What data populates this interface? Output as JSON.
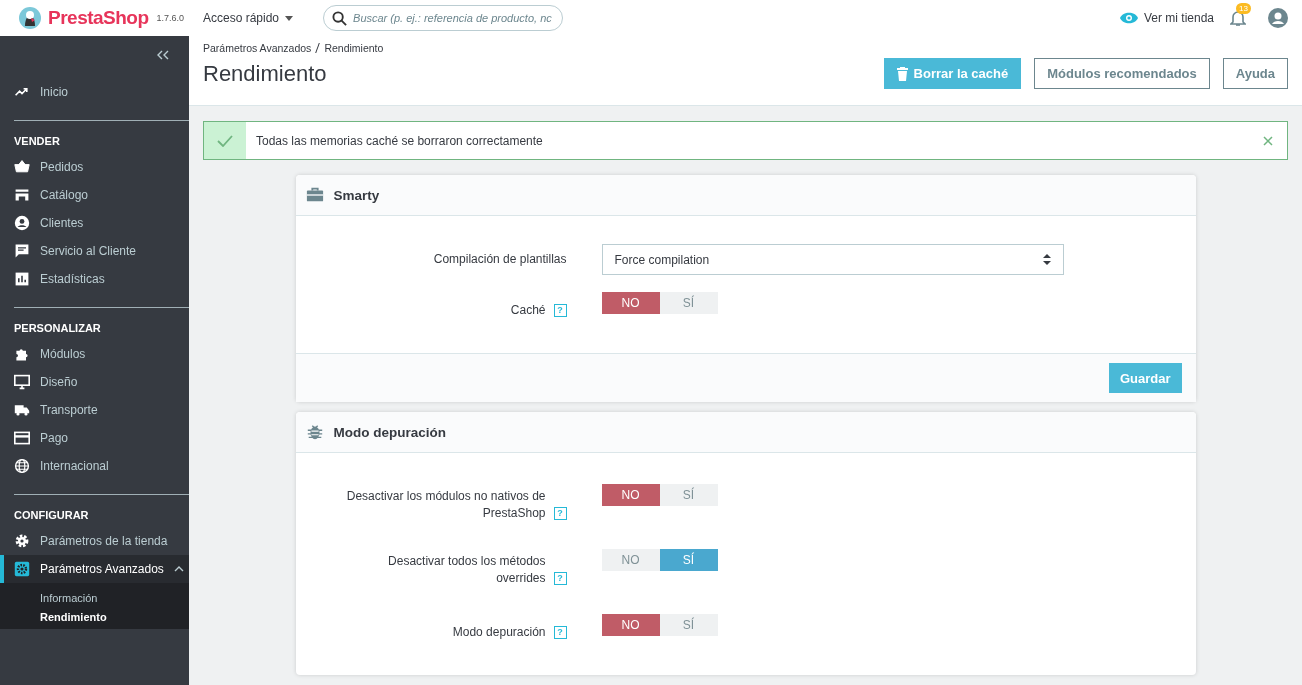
{
  "header": {
    "logo": "PrestaShop",
    "version": "1.7.6.0",
    "quick_access": "Acceso rápido",
    "search": {
      "placeholder": "Buscar (p. ej.: referencia de producto, nc"
    },
    "view_store": "Ver mi tienda",
    "notifications": "13"
  },
  "sidebar": {
    "top": [
      {
        "label": "Inicio"
      }
    ],
    "sections": [
      {
        "title": "VENDER",
        "items": [
          {
            "label": "Pedidos",
            "selected": false
          },
          {
            "label": "Catálogo",
            "selected": false
          },
          {
            "label": "Clientes",
            "selected": false
          },
          {
            "label": "Servicio al Cliente",
            "selected": false
          },
          {
            "label": "Estadísticas",
            "selected": false
          }
        ]
      },
      {
        "title": "PERSONALIZAR",
        "items": [
          {
            "label": "Módulos",
            "selected": false
          },
          {
            "label": "Diseño",
            "selected": false
          },
          {
            "label": "Transporte",
            "selected": false
          },
          {
            "label": "Pago",
            "selected": false
          },
          {
            "label": "Internacional",
            "selected": false
          }
        ]
      },
      {
        "title": "CONFIGURAR",
        "items": [
          {
            "label": "Parámetros de la tienda",
            "selected": false
          },
          {
            "label": "Parámetros Avanzados",
            "selected": true,
            "expanded": true,
            "children": [
              {
                "label": "Información",
                "selected": false
              },
              {
                "label": "Rendimiento",
                "selected": true
              }
            ]
          }
        ]
      }
    ]
  },
  "breadcrumb": [
    "Parámetros Avanzados",
    "Rendimiento"
  ],
  "page_title": "Rendimiento",
  "toolbar": [
    {
      "label": "Borrar la caché",
      "kind": "primary"
    },
    {
      "label": "Módulos recomendados",
      "kind": "outline"
    },
    {
      "label": "Ayuda",
      "kind": "outline"
    }
  ],
  "alert": {
    "message": "Todas las memorias caché se borraron correctamente"
  },
  "panels": [
    {
      "title": "Smarty",
      "fields": [
        {
          "kind": "select",
          "label": "Compilación de plantillas",
          "value": "Force compilation"
        },
        {
          "kind": "toggle",
          "label": "Caché",
          "help": "?",
          "options": [
            {
              "label": "NO",
              "kind": "off",
              "selected": true
            },
            {
              "label": "SÍ",
              "kind": "on",
              "selected": false
            }
          ]
        }
      ],
      "save": "Guardar"
    },
    {
      "title": "Modo depuración",
      "fields": [
        {
          "kind": "toggle",
          "label": "Desactivar los módulos no nativos de PrestaShop",
          "help": "?",
          "options": [
            {
              "label": "NO",
              "kind": "off",
              "selected": true
            },
            {
              "label": "SÍ",
              "kind": "on",
              "selected": false
            }
          ]
        },
        {
          "kind": "toggle",
          "label": "Desactivar todos los métodos overrides",
          "help": "?",
          "options": [
            {
              "label": "NO",
              "kind": "off",
              "selected": false
            },
            {
              "label": "SÍ",
              "kind": "on",
              "selected": true
            }
          ]
        },
        {
          "kind": "toggle",
          "label": "Modo depuración",
          "help": "?",
          "options": [
            {
              "label": "NO",
              "kind": "off",
              "selected": true
            },
            {
              "label": "SÍ",
              "kind": "on",
              "selected": false
            }
          ]
        }
      ]
    }
  ]
}
